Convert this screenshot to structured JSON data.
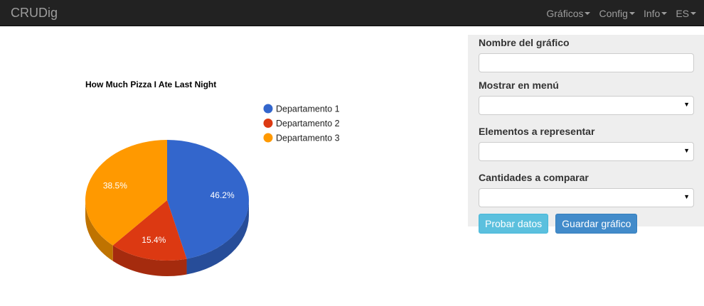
{
  "navbar": {
    "brand": "CRUDig",
    "menu": [
      {
        "label": "Gráficos"
      },
      {
        "label": "Config"
      },
      {
        "label": "Info"
      },
      {
        "label": "ES"
      }
    ]
  },
  "chart_data": {
    "type": "pie",
    "title": "How Much Pizza I Ate Last Night",
    "categories": [
      "Departamento 1",
      "Departamento 2",
      "Departamento 3"
    ],
    "values": [
      46.2,
      15.4,
      38.5
    ],
    "labels": [
      "46.2%",
      "15.4%",
      "38.5%"
    ],
    "colors": [
      "#3366cc",
      "#dc3912",
      "#ff9900"
    ],
    "side_colors": [
      "#274d99",
      "#a52b0e",
      "#bf7300"
    ],
    "legend_position": "right",
    "style": "3d"
  },
  "form": {
    "name_label": "Nombre del gráfico",
    "name_value": "",
    "menu_label": "Mostrar en menú",
    "menu_value": "",
    "elements_label": "Elementos a representar",
    "elements_value": "",
    "quantities_label": "Cantidades a comparar",
    "quantities_value": "",
    "select_arrow": "▼",
    "test_button": "Probar datos",
    "save_button": "Guardar gráfico"
  }
}
